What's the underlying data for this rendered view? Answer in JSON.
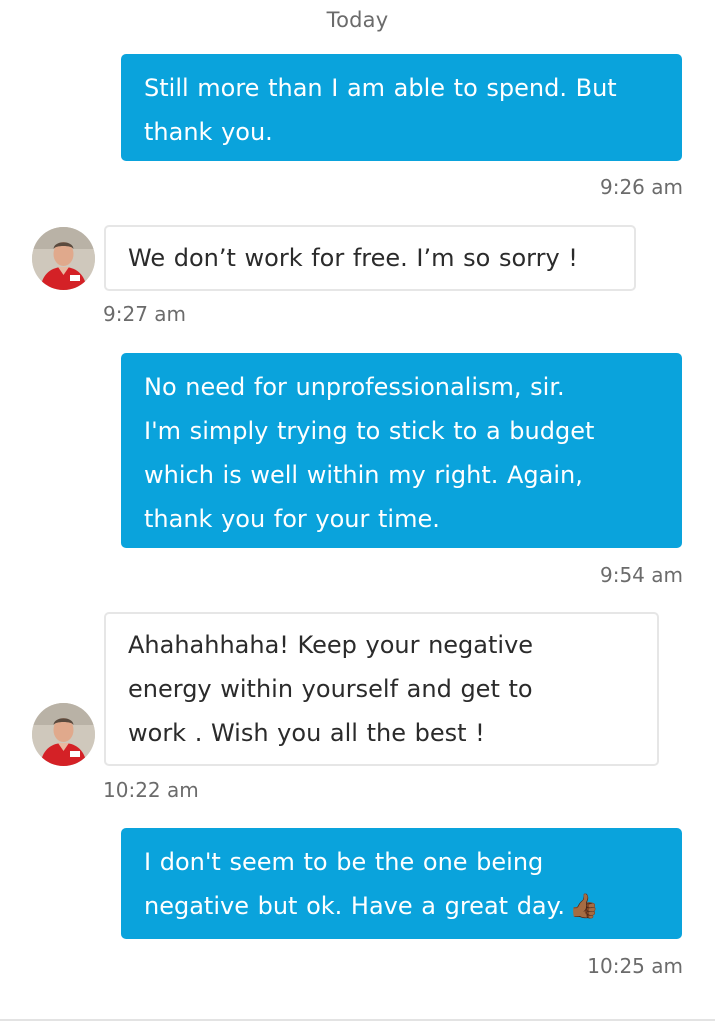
{
  "conversation": {
    "day_separator": "Today",
    "messages": [
      {
        "direction": "outgoing",
        "lines": [
          "Still more than I am able to spend. But",
          "thank you."
        ],
        "time": "9:26 am"
      },
      {
        "direction": "incoming",
        "lines": [
          "We don’t work for free. I’m so sorry !"
        ],
        "time": "9:27 am"
      },
      {
        "direction": "outgoing",
        "lines": [
          "No need for unprofessionalism, sir.",
          "I'm simply trying to stick to a budget",
          "which is well within my right. Again,",
          "thank you for your time."
        ],
        "time": "9:54 am"
      },
      {
        "direction": "incoming",
        "lines": [
          "Ahahahhaha! Keep your negative",
          "energy within yourself and get to",
          "work . Wish you all the best !"
        ],
        "time": "10:22 am"
      },
      {
        "direction": "outgoing",
        "lines": [
          "I don't seem to be the one being",
          "negative but ok. Have a great day."
        ],
        "emoji": "👍🏾",
        "time": "10:25 am"
      }
    ]
  },
  "colors": {
    "outgoing_bubble": "#0aa3dc",
    "incoming_border": "#e6e6e6",
    "meta_text": "#6b6b6b"
  }
}
